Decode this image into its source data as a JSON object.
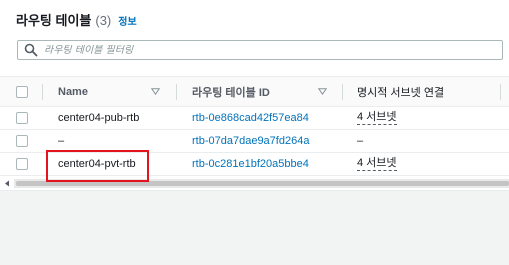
{
  "header": {
    "title": "라우팅 테이블",
    "count": "(3)",
    "info_label": "정보"
  },
  "search": {
    "placeholder": "라우팅 테이블 필터링",
    "value": ""
  },
  "table": {
    "columns": {
      "name": "Name",
      "id": "라우팅 테이블 ID",
      "subnets": "명시적 서브넷 연결"
    },
    "rows": [
      {
        "name": "center04-pub-rtb",
        "id": "rtb-0e868cad42f57ea84",
        "subnets": "4 서브넷"
      },
      {
        "name": "–",
        "id": "rtb-07da7dae9a7fd264a",
        "subnets": "–"
      },
      {
        "name": "center04-pvt-rtb",
        "id": "rtb-0c281e1bf20a5bbe4",
        "subnets": "4 서브넷"
      }
    ]
  },
  "colors": {
    "link": "#0073bb",
    "highlight": "#e3141b"
  },
  "icons": [
    "search-icon",
    "sort-down-icon",
    "scroll-left-icon"
  ]
}
